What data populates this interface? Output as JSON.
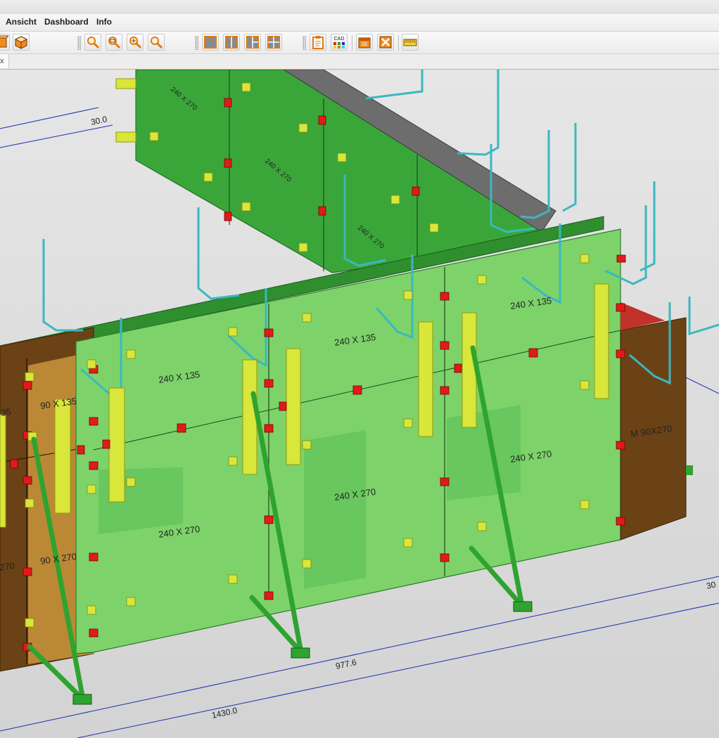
{
  "menu": {
    "items": [
      "Ansicht",
      "Dashboard",
      "Info"
    ]
  },
  "toolbar": {
    "buttons": [
      "view-3d-icon",
      "cube-icon",
      "zoom-icon",
      "zoom-window-icon",
      "zoom-in-icon",
      "zoom-extents-icon",
      "layout-single-icon",
      "layout-split-vertical-icon",
      "layout-three-icon",
      "layout-four-icon",
      "clipboard-icon",
      "cad-icon",
      "calendar-icon",
      "cancel-icon",
      "measure-icon"
    ],
    "cad_label": "CAD"
  },
  "tab": {
    "close_glyph": "x"
  },
  "viewport": {
    "dimension_labels": [
      "30.0",
      "977.6",
      "1430.0",
      "30"
    ],
    "panel_labels": [
      "240 X 270",
      "240 X 270",
      "240 X 270",
      "240 X 135",
      "240 X 135",
      "240 X 135",
      "240 X 270",
      "240 X 270",
      "240 X 270",
      "90 X 135",
      "90 X 270",
      "M 90X270",
      "35",
      "270"
    ],
    "colors": {
      "panel_dark_green": "#3aa63a",
      "panel_light_green": "#7dd36a",
      "panel_brown": "#6b4216",
      "waler_yellow": "#d9e63a",
      "clamp_red": "#e01b1b",
      "rail_cyan": "#3ab8c0",
      "brace_green": "#2fa32f",
      "dimension_blue": "#1a2fb0"
    }
  }
}
